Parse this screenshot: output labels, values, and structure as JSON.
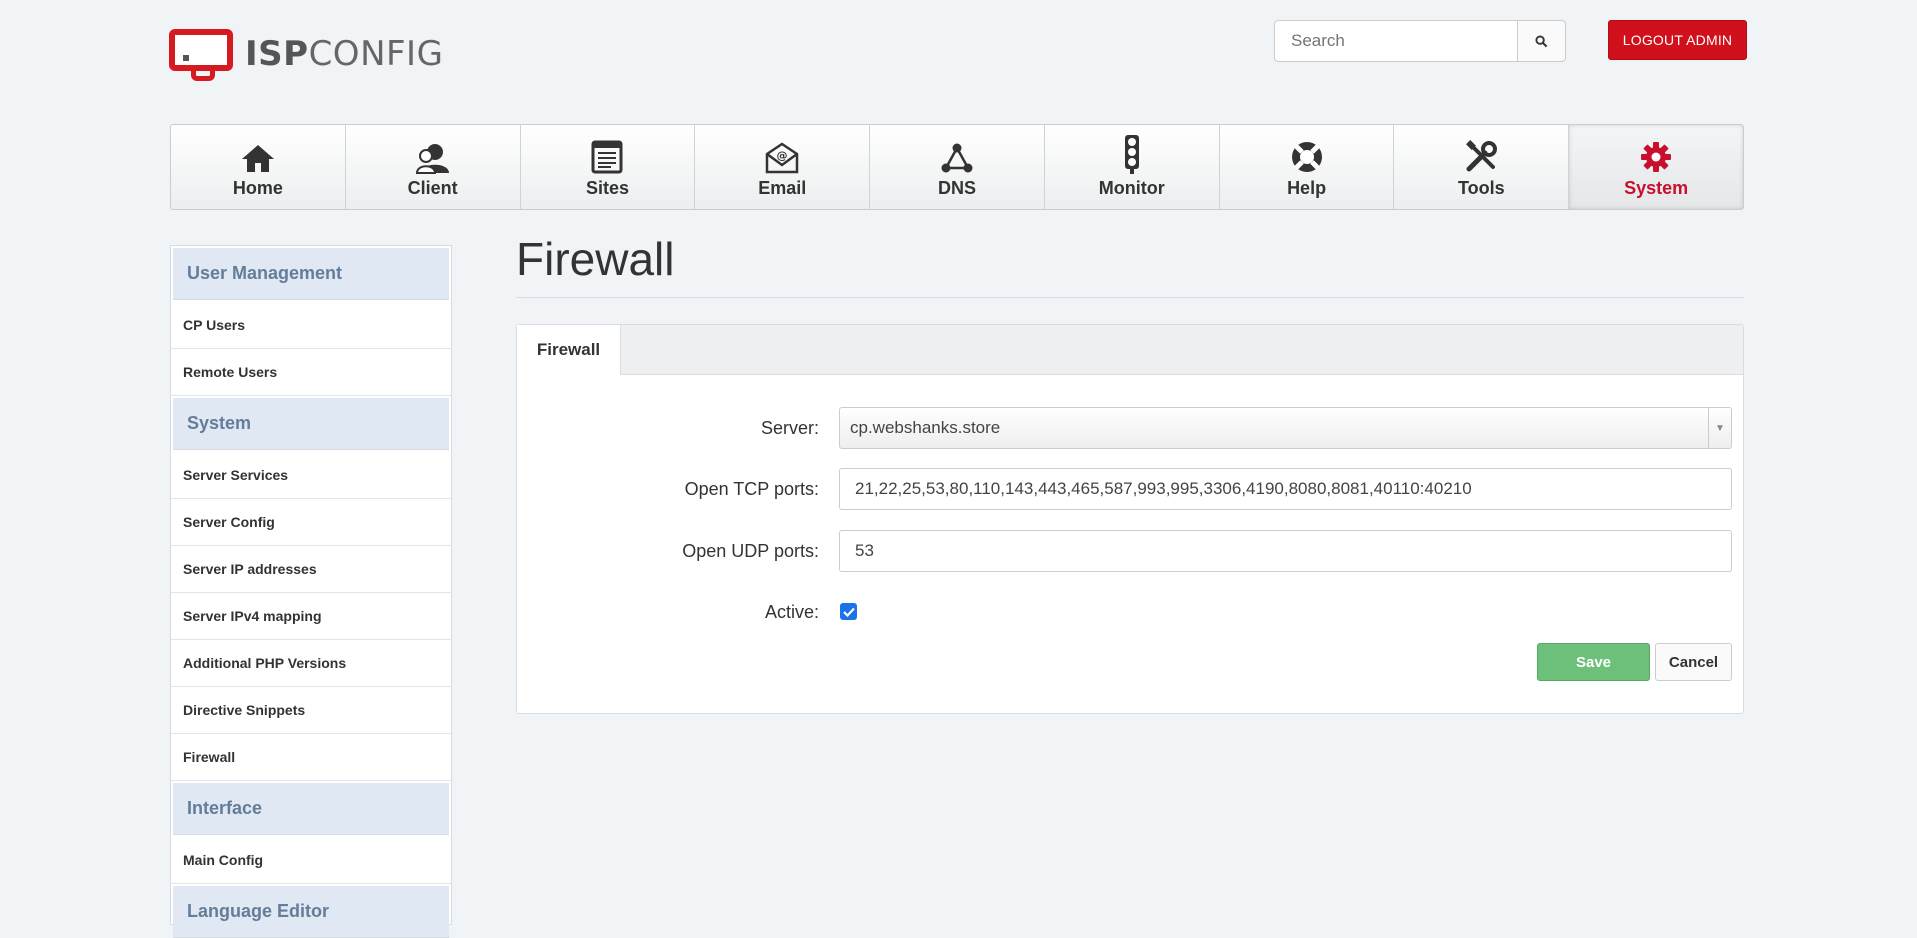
{
  "header": {
    "logo_bold": "ISP",
    "logo_light": "CONFIG",
    "search_placeholder": "Search",
    "logout_label": "LOGOUT ADMIN"
  },
  "nav": [
    {
      "label": "Home",
      "icon": "home-icon"
    },
    {
      "label": "Client",
      "icon": "client-icon"
    },
    {
      "label": "Sites",
      "icon": "sites-icon"
    },
    {
      "label": "Email",
      "icon": "email-icon"
    },
    {
      "label": "DNS",
      "icon": "dns-icon"
    },
    {
      "label": "Monitor",
      "icon": "monitor-icon"
    },
    {
      "label": "Help",
      "icon": "help-icon"
    },
    {
      "label": "Tools",
      "icon": "tools-icon"
    },
    {
      "label": "System",
      "icon": "gear-icon",
      "active": true
    }
  ],
  "sidebar": {
    "user_management": {
      "heading": "User Management",
      "items": [
        "CP Users",
        "Remote Users"
      ]
    },
    "system": {
      "heading": "System",
      "items": [
        "Server Services",
        "Server Config",
        "Server IP addresses",
        "Server IPv4 mapping",
        "Additional PHP Versions",
        "Directive Snippets",
        "Firewall"
      ]
    },
    "interface": {
      "heading": "Interface",
      "items": [
        "Main Config"
      ]
    },
    "language_editor": {
      "heading": "Language Editor"
    }
  },
  "main": {
    "title": "Firewall",
    "tab_label": "Firewall",
    "form": {
      "server_label": "Server:",
      "server_value": "cp.webshanks.store",
      "tcp_label": "Open TCP ports:",
      "tcp_value": "21,22,25,53,80,110,143,443,465,587,993,995,3306,4190,8080,8081,40110:40210",
      "udp_label": "Open UDP ports:",
      "udp_value": "53",
      "active_label": "Active:",
      "active_checked": true
    },
    "save_label": "Save",
    "cancel_label": "Cancel"
  },
  "colors": {
    "brand_red": "#d0101b",
    "active_nav": "#c8102e",
    "save_green": "#6dc07a",
    "sidebar_heading_bg": "#dfe8f3",
    "sidebar_heading_text": "#647d99"
  }
}
